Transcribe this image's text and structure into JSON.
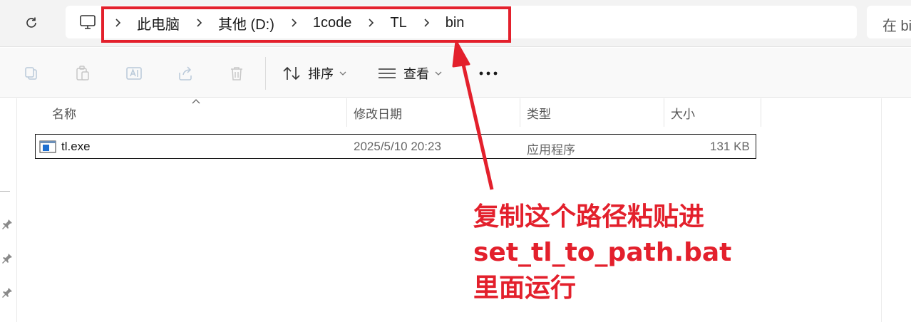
{
  "address_bar": {
    "breadcrumbs": [
      "此电脑",
      "其他 (D:)",
      "1code",
      "TL",
      "bin"
    ]
  },
  "search": {
    "placeholder": "在 bin"
  },
  "toolbar": {
    "sort_label": "排序",
    "view_label": "查看"
  },
  "columns": {
    "name": "名称",
    "modified": "修改日期",
    "type": "类型",
    "size": "大小"
  },
  "files": [
    {
      "name": "tl.exe",
      "modified": "2025/5/10 20:23",
      "type": "应用程序",
      "size": "131 KB"
    }
  ],
  "annotation": {
    "lines": [
      "复制这个路径粘贴进",
      "set_tl_to_path.bat",
      "里面运行"
    ],
    "color": "#e3202c"
  },
  "icons": [
    "refresh-icon",
    "this-pc-icon",
    "chevron-right-icon",
    "copy-icon",
    "paste-icon",
    "rename-icon",
    "share-icon",
    "delete-icon",
    "sort-icon",
    "view-icon",
    "more-icon",
    "pin-icon",
    "exe-file-icon"
  ]
}
